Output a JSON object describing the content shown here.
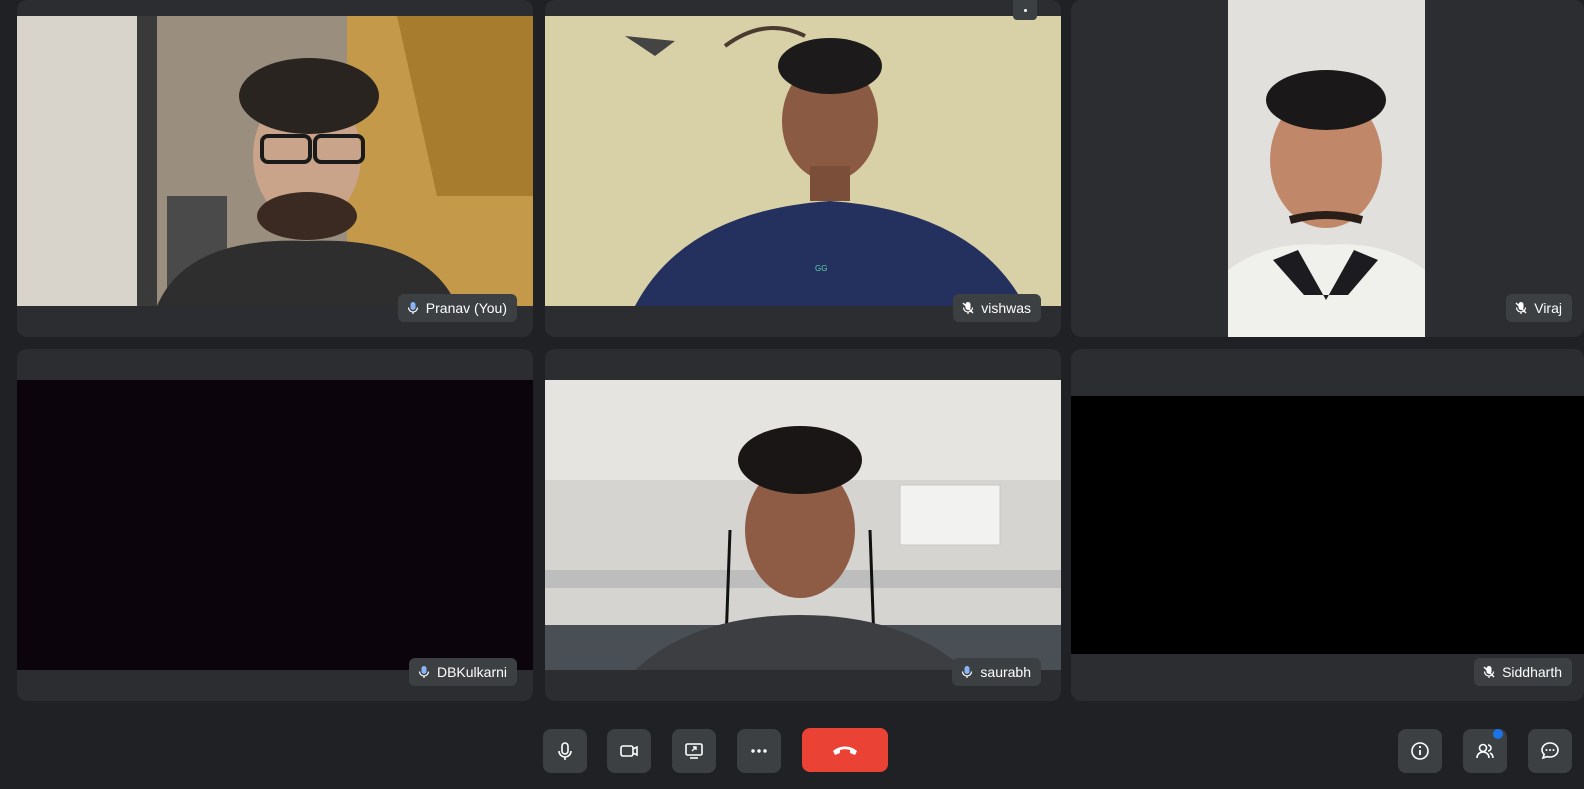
{
  "participants": [
    {
      "name": "Pranav (You)",
      "mic": "on"
    },
    {
      "name": "vishwas",
      "mic": "off"
    },
    {
      "name": "Viraj",
      "mic": "off"
    },
    {
      "name": "DBKulkarni",
      "mic": "on"
    },
    {
      "name": "saurabh",
      "mic": "on"
    },
    {
      "name": "Siddharth",
      "mic": "off"
    }
  ],
  "toolbar": {
    "mic": "microphone-icon",
    "camera": "camera-icon",
    "share": "screen-share-icon",
    "more": "more-options-icon",
    "end": "end-call-icon",
    "info": "info-icon",
    "people": "people-icon",
    "chat": "chat-icon"
  },
  "colors": {
    "background": "#202124",
    "tile": "#2b2d31",
    "end_call": "#ea4335",
    "mic_on": "#8ab4f8"
  }
}
